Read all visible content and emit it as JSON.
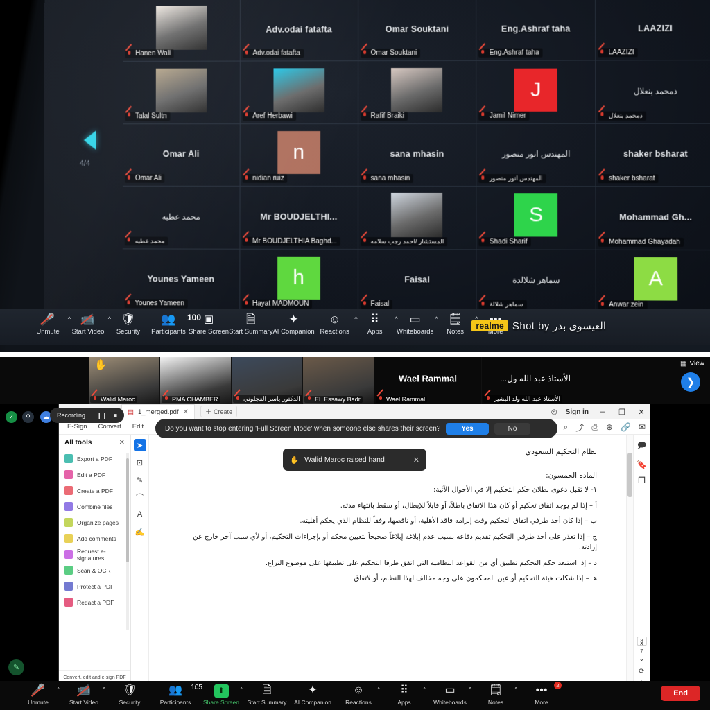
{
  "top_screen": {
    "page_indicator": "4/4",
    "prev_arrow_icon": "left-triangle-arrow",
    "gallery": [
      {
        "name_center": "",
        "label": "Hanen Wali",
        "kind": "photo",
        "tone": "#efe9e2",
        "rtl": false,
        "center_rtl": false
      },
      {
        "name_center": "Adv.odai fatafta",
        "label": "Adv.odai fatafta",
        "kind": "none",
        "tone": "",
        "rtl": false,
        "center_rtl": false
      },
      {
        "name_center": "Omar Souktani",
        "label": "Omar Souktani",
        "kind": "none",
        "tone": "",
        "rtl": false,
        "center_rtl": false
      },
      {
        "name_center": "Eng.Ashraf taha",
        "label": "Eng.Ashraf taha",
        "kind": "none",
        "tone": "",
        "rtl": false,
        "center_rtl": false
      },
      {
        "name_center": "LAAZIZI",
        "label": "LAAZIZI",
        "kind": "none",
        "tone": "",
        "rtl": false,
        "center_rtl": false
      },
      {
        "name_center": "",
        "label": "Talal Sultn",
        "kind": "photo",
        "tone": "#b6a68c",
        "rtl": false,
        "center_rtl": false
      },
      {
        "name_center": "",
        "label": "Aref Herbawi",
        "kind": "photo",
        "tone": "#28c8e8",
        "rtl": false,
        "center_rtl": false
      },
      {
        "name_center": "",
        "label": "Rafif Braiki",
        "kind": "photo",
        "tone": "#d8c9c2",
        "rtl": false,
        "center_rtl": false
      },
      {
        "name_center": "",
        "label": "Jamil Nimer",
        "kind": "initial",
        "initial": "J",
        "tone": "#e8262a",
        "rtl": false,
        "center_rtl": false
      },
      {
        "name_center": "ذمحمد بنعلال",
        "label": "ذمحمد بنعلال",
        "kind": "none",
        "tone": "",
        "rtl": true,
        "center_rtl": true
      },
      {
        "name_center": "Omar Ali",
        "label": "Omar Ali",
        "kind": "none",
        "tone": "",
        "rtl": false,
        "center_rtl": false
      },
      {
        "name_center": "",
        "label": "nidian ruiz",
        "kind": "initial",
        "initial": "n",
        "tone": "#b07260",
        "rtl": false,
        "center_rtl": false
      },
      {
        "name_center": "sana mhasin",
        "label": "sana mhasin",
        "kind": "none",
        "tone": "",
        "rtl": false,
        "center_rtl": false
      },
      {
        "name_center": "المهندس انور منصور",
        "label": "المهندس انور منصور",
        "kind": "none",
        "tone": "",
        "rtl": true,
        "center_rtl": true
      },
      {
        "name_center": "shaker bsharat",
        "label": "shaker bsharat",
        "kind": "none",
        "tone": "",
        "rtl": false,
        "center_rtl": false
      },
      {
        "name_center": "محمد عطيه",
        "label": "محمد عطيه",
        "kind": "none",
        "tone": "",
        "rtl": true,
        "center_rtl": true
      },
      {
        "name_center": "Mr BOUDJELTHI...",
        "label": "Mr BOUDJELTHIA Baghd...",
        "kind": "none",
        "tone": "",
        "rtl": false,
        "center_rtl": false
      },
      {
        "name_center": "",
        "label": "المستشار /أحمد رجب سلامه",
        "kind": "photo",
        "tone": "#cfd6df",
        "rtl": true,
        "center_rtl": false
      },
      {
        "name_center": "",
        "label": "Shadi Sharif",
        "kind": "initial",
        "initial": "S",
        "tone": "#2ed44b",
        "rtl": false,
        "center_rtl": false
      },
      {
        "name_center": "Mohammad  Gh...",
        "label": "Mohammad Ghayadah",
        "kind": "none",
        "tone": "",
        "rtl": false,
        "center_rtl": false
      },
      {
        "name_center": "Younes Yameen",
        "label": "Younes Yameen",
        "kind": "none",
        "tone": "",
        "rtl": false,
        "center_rtl": false
      },
      {
        "name_center": "",
        "label": "Hayat MADMOUN",
        "kind": "initial",
        "initial": "h",
        "tone": "#5fd83f",
        "rtl": false,
        "center_rtl": false
      },
      {
        "name_center": "Faisal",
        "label": "Faisal",
        "kind": "none",
        "tone": "",
        "rtl": false,
        "center_rtl": false
      },
      {
        "name_center": "سماهر شلالدة",
        "label": "سماهر شلالة",
        "kind": "none",
        "tone": "",
        "rtl": true,
        "center_rtl": true
      },
      {
        "name_center": "",
        "label": "Anwar zein",
        "kind": "initial",
        "initial": "A",
        "tone": "#8ddc44",
        "rtl": false,
        "center_rtl": false
      }
    ],
    "toolbar": [
      {
        "label": "Unmute",
        "icon": "microphone-off-icon",
        "caret": true,
        "count": ""
      },
      {
        "label": "Start Video",
        "icon": "video-off-icon",
        "caret": true,
        "count": ""
      },
      {
        "label": "Security",
        "icon": "shield-icon",
        "caret": false,
        "count": ""
      },
      {
        "label": "Participants",
        "icon": "participants-icon",
        "caret": true,
        "count": "100"
      },
      {
        "label": "Share Screen",
        "icon": "share-screen-icon",
        "caret": false,
        "count": ""
      },
      {
        "label": "Start Summary",
        "icon": "document-icon",
        "caret": false,
        "count": ""
      },
      {
        "label": "AI Companion",
        "icon": "sparkle-icon",
        "caret": false,
        "count": ""
      },
      {
        "label": "Reactions",
        "icon": "smiley-icon",
        "caret": true,
        "count": ""
      },
      {
        "label": "Apps",
        "icon": "apps-icon",
        "caret": true,
        "count": ""
      },
      {
        "label": "Whiteboards",
        "icon": "whiteboard-icon",
        "caret": true,
        "count": ""
      },
      {
        "label": "Notes",
        "icon": "notes-icon",
        "caret": true,
        "count": ""
      },
      {
        "label": "More",
        "icon": "ellipsis-icon",
        "caret": false,
        "count": ""
      }
    ],
    "watermark": {
      "brand": "realme",
      "text": "Shot by العيسوى بدر"
    }
  },
  "bottom_screen": {
    "filmstrip": [
      {
        "center": "",
        "label": "Walid Maroc",
        "raised_hand": true,
        "rtl": false,
        "tone": "#9d8d76"
      },
      {
        "center": "",
        "label": "PMA CHAMBER",
        "raised_hand": false,
        "rtl": false,
        "tone": "#f2f2f2"
      },
      {
        "center": "",
        "label": "الدكتور ياسر العجلوني",
        "raised_hand": false,
        "rtl": true,
        "tone": "#3d4a5c"
      },
      {
        "center": "",
        "label": "EL Essawy Badr",
        "raised_hand": false,
        "rtl": false,
        "tone": "#6b5a49"
      },
      {
        "center": "Wael Rammal",
        "label": "Wael Rammal",
        "raised_hand": false,
        "rtl": false,
        "tone": ""
      },
      {
        "center": "الأستاذ عبد الله ول...",
        "label": "الأستاذ عبد الله ولد البشير",
        "raised_hand": false,
        "rtl": true,
        "tone": ""
      }
    ],
    "view_button": {
      "label": "View",
      "icon": "grid-view-icon"
    },
    "next_arrow_icon": "chevron-right-circle-icon",
    "recording_pill": {
      "label": "Recording...",
      "pause_icon": "pause-icon",
      "stop_icon": "stop-icon"
    },
    "fullscreen_banner": {
      "message": "Do you want to stop entering 'Full Screen Mode' when someone else shares their screen?",
      "yes_label": "Yes",
      "no_label": "No"
    },
    "raised_hand_toast": {
      "text": "Walid Maroc raised hand",
      "hand_icon": "raised-hand-icon",
      "close_icon": "close-icon"
    },
    "acrobat": {
      "tab_title": "1_merged.pdf",
      "create_label": "Create",
      "sign_in_label": "Sign in",
      "help_icon": "help-circle-icon",
      "window_controls": {
        "minimize": "–",
        "maximize": "❐",
        "close": "✕"
      },
      "menus": [
        "All tools",
        "Edit",
        "Convert",
        "E-Sign"
      ],
      "title_tools": [
        "share-icon",
        "print-icon",
        "add-stamp-icon",
        "link-icon",
        "mail-icon"
      ],
      "sidebar": {
        "heading": "All tools",
        "close_icon": "close-icon",
        "items": [
          {
            "label": "Export a PDF",
            "icon": "export-pdf-icon",
            "color": "#2bb3a3"
          },
          {
            "label": "Edit a PDF",
            "icon": "edit-pdf-icon",
            "color": "#e0489a"
          },
          {
            "label": "Create a PDF",
            "icon": "create-pdf-icon",
            "color": "#e8515d"
          },
          {
            "label": "Combine files",
            "icon": "combine-files-icon",
            "color": "#7f63e0"
          },
          {
            "label": "Organize pages",
            "icon": "organize-pages-icon",
            "color": "#b9cf3f"
          },
          {
            "label": "Add comments",
            "icon": "add-comments-icon",
            "color": "#e4c93a"
          },
          {
            "label": "Request e-signatures",
            "icon": "request-esign-icon",
            "color": "#c256e0"
          },
          {
            "label": "Scan & OCR",
            "icon": "scan-ocr-icon",
            "color": "#3ec46d"
          },
          {
            "label": "Protect a PDF",
            "icon": "protect-pdf-icon",
            "color": "#5c63c9"
          },
          {
            "label": "Redact a PDF",
            "icon": "redact-pdf-icon",
            "color": "#e0406b"
          }
        ],
        "footer": "Convert, edit and e-sign PDF forms & agreements"
      },
      "vertical_tools": [
        "select-tool-icon",
        "add-text-box-icon",
        "draw-icon",
        "highlight-icon",
        "text-comment-icon",
        "signature-icon"
      ],
      "document": {
        "title": "نظام التحكيم السعودي",
        "heading": "المادة الخمسون:",
        "paragraphs": [
          "١- لا تقبل دعوى بطلان حكم التحكيم إلا في الأحوال الآتية:",
          "أ – إذا لم يوجد اتفاق تحكيم أو كان هذا الاتفاق باطلاً، أو قابلاً للإبطال، أو سقط بانتهاء مدته.",
          "ب – إذا كان أحد طرفي اتفاق التحكيم وقت إبرامه فاقد الأهلية، أو ناقصها، وفقاً للنظام الذي يحكم أهليته.",
          "ج – إذا تعذر على أحد طرفي التحكيم تقديم دفاعه بسبب عدم إبلاغه إبلاغاً صحيحاً بتعيين محكم أو بإجراءات التحكيم، أو لأي سبب آخر خارج عن إرادته.",
          "د – إذا استبعد حكم التحكيم تطبيق أي من القواعد النظامية التي اتفق طرفا التحكيم على تطبيقها على موضوع النزاع.",
          "هـ – إذا شكلت هيئة التحكيم أو عين المحكمون على وجه مخالف لهذا النظام، أو لاتفاق"
        ]
      },
      "right_rail": {
        "icons": [
          "comment-icon",
          "bookmark-icon",
          "pages-thumbnail-icon"
        ],
        "current_page": "3",
        "total_pages": "7",
        "prev_page_icon": "chevron-up-icon",
        "next_page_icon": "chevron-down-icon",
        "rotate_icon": "rotate-icon"
      }
    },
    "toolbar": [
      {
        "label": "Unmute",
        "icon": "microphone-off-icon",
        "caret": true,
        "count": "",
        "green": false
      },
      {
        "label": "Start Video",
        "icon": "video-off-icon",
        "caret": true,
        "count": "",
        "green": false
      },
      {
        "label": "Security",
        "icon": "shield-icon",
        "caret": false,
        "count": "",
        "green": false
      },
      {
        "label": "Participants",
        "icon": "participants-icon",
        "caret": true,
        "count": "105",
        "green": false
      },
      {
        "label": "Share Screen",
        "icon": "share-screen-icon",
        "caret": true,
        "count": "",
        "green": true
      },
      {
        "label": "Start Summary",
        "icon": "document-icon",
        "caret": false,
        "count": "",
        "green": false
      },
      {
        "label": "AI Companion",
        "icon": "sparkle-icon",
        "caret": false,
        "count": "",
        "green": false
      },
      {
        "label": "Reactions",
        "icon": "smiley-icon",
        "caret": true,
        "count": "",
        "green": false
      },
      {
        "label": "Apps",
        "icon": "apps-icon",
        "caret": true,
        "count": "",
        "green": false
      },
      {
        "label": "Whiteboards",
        "icon": "whiteboard-icon",
        "caret": true,
        "count": "",
        "green": false
      },
      {
        "label": "Notes",
        "icon": "notes-icon",
        "caret": true,
        "count": "",
        "green": false
      },
      {
        "label": "More",
        "icon": "ellipsis-icon",
        "caret": false,
        "count": "",
        "green": false,
        "badge": "2"
      }
    ],
    "end_button": {
      "label": "End"
    }
  }
}
